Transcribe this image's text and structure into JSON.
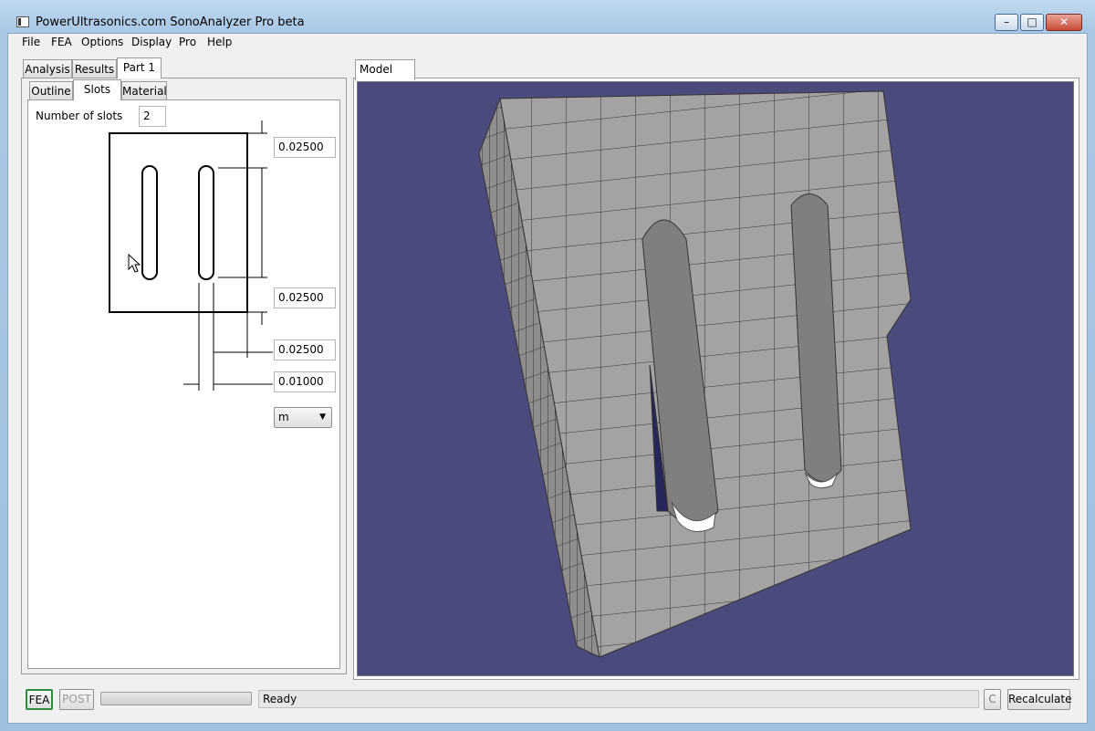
{
  "window": {
    "title": "PowerUltrasonics.com SonoAnalyzer Pro beta",
    "controls": {
      "minimize": "–",
      "maximize": "□",
      "close": "✕"
    }
  },
  "menu": [
    "File",
    "FEA",
    "Options",
    "Display",
    "Pro",
    "Help"
  ],
  "left_tabs": [
    "Analysis",
    "Results",
    "Part 1"
  ],
  "sub_tabs": [
    "Outline",
    "Slots",
    "Material"
  ],
  "slots": {
    "count_label": "Number of slots",
    "count_value": "2",
    "dimensions": [
      "0.02500",
      "0.02500",
      "0.02500",
      "0.01000"
    ],
    "unit": "m"
  },
  "model_tab": "Model",
  "status": {
    "fea_button": "FEA",
    "post_button": "POST",
    "progress": 0,
    "text": "Ready",
    "c_button": "C",
    "recalc_button": "Recalculate"
  },
  "colors": {
    "viewport_bg": "#4a4a7c",
    "mesh_face": "#a3a3a3",
    "mesh_edge": "#333333"
  },
  "icons": {
    "cursor": "mouse-pointer-icon",
    "dropdown": "chevron-down-icon"
  }
}
